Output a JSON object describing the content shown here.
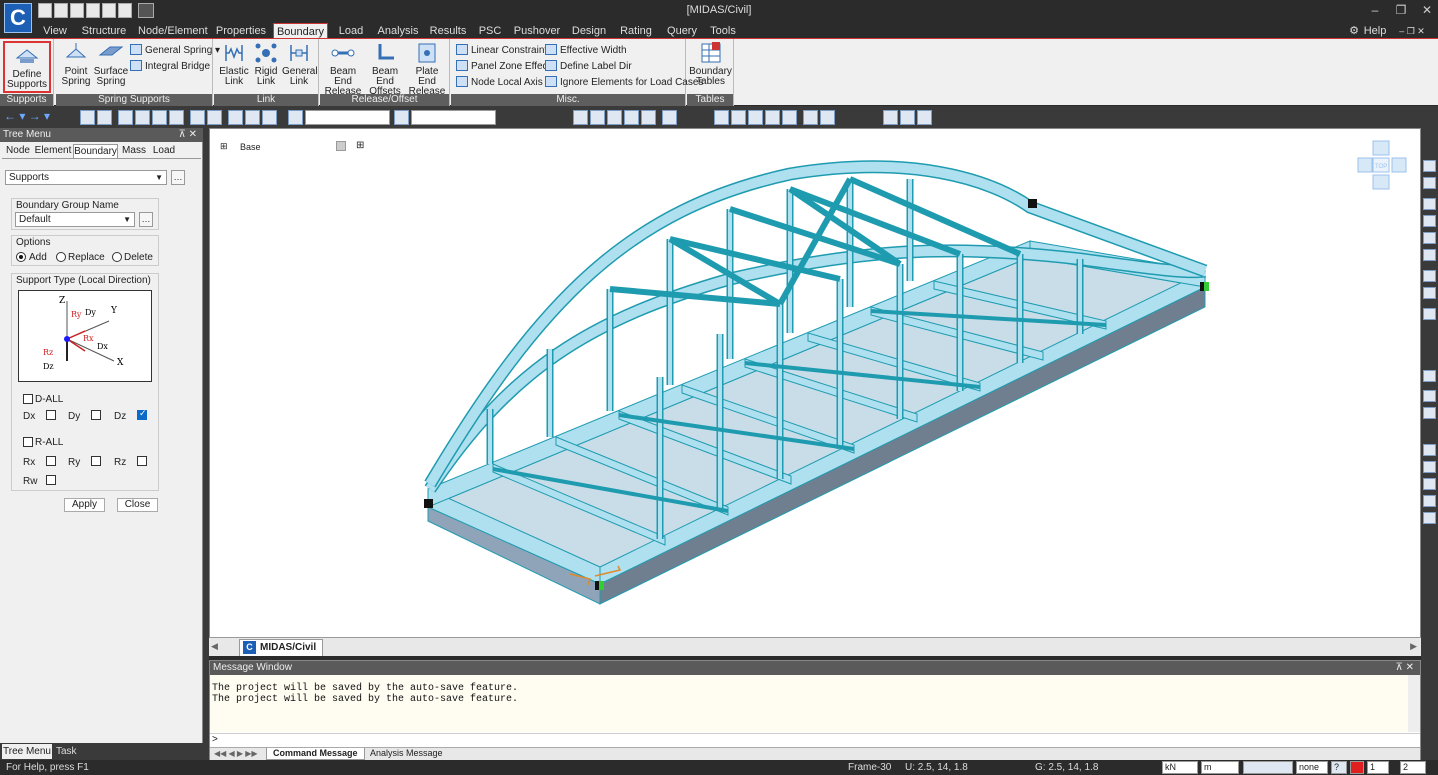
{
  "app": {
    "title": "[MIDAS/Civil]",
    "help": "Help"
  },
  "menu": [
    "View",
    "Structure",
    "Node/Element",
    "Properties",
    "Boundary",
    "Load",
    "Analysis",
    "Results",
    "PSC",
    "Pushover",
    "Design",
    "Rating",
    "Query",
    "Tools"
  ],
  "ribbon": {
    "supports": {
      "define": "Define\nSupports",
      "group": "Supports"
    },
    "spring": {
      "point": "Point\nSpring",
      "surface": "Surface\nSpring",
      "general": "General Spring",
      "integral": "Integral Bridge",
      "group": "Spring Supports"
    },
    "link": {
      "elastic": "Elastic\nLink",
      "rigid": "Rigid\nLink",
      "general": "General\nLink",
      "group": "Link"
    },
    "release": {
      "beam_end_release": "Beam End\nRelease",
      "beam_end_offsets": "Beam End\nOffsets",
      "plate_end_release": "Plate End\nRelease",
      "group": "Release/Offset"
    },
    "misc": {
      "linear": "Linear Constraints",
      "panel": "Panel Zone Effects",
      "node_axis": "Node Local Axis",
      "eff_width": "Effective Width",
      "label_dir": "Define Label Dir",
      "ignore": "Ignore Elements for Load Cases",
      "group": "Misc."
    },
    "tables": {
      "boundary": "Boundary\nTables",
      "group": "Tables"
    }
  },
  "tree": {
    "title": "Tree Menu",
    "tabs": [
      "Node",
      "Element",
      "Boundary",
      "Mass",
      "Load"
    ],
    "active_tab": "Boundary",
    "function": "Supports",
    "group_label": "Boundary Group Name",
    "group_value": "Default",
    "options_label": "Options",
    "options": [
      "Add",
      "Replace",
      "Delete"
    ],
    "support_type_label": "Support Type (Local Direction)",
    "diagram_labels": {
      "z": "Z",
      "y": "Y",
      "x": "X",
      "dy": "Dy",
      "dx": "Dx",
      "dz": "Dz",
      "ry": "Ry",
      "rx": "Rx",
      "rz": "Rz"
    },
    "d_all": "D-ALL",
    "r_all": "R-ALL",
    "dofs": {
      "dx": "Dx",
      "dy": "Dy",
      "dz": "Dz",
      "rx": "Rx",
      "ry": "Ry",
      "rz": "Rz",
      "rw": "Rw"
    },
    "apply": "Apply",
    "close": "Close",
    "bottom_tabs": [
      "Tree Menu",
      "Task Pane"
    ]
  },
  "view": {
    "base_label": "Base",
    "tab": "MIDAS/Civil",
    "cube_label": "TOP"
  },
  "messages": {
    "title": "Message Window",
    "lines": [
      "The project will be saved by the auto-save feature.",
      "The project will be saved by the auto-save feature."
    ],
    "prompt": ">",
    "tabs": [
      "Command Message",
      "Analysis Message"
    ]
  },
  "status": {
    "help": "For Help, press F1",
    "frame": "Frame-30",
    "u": "U: 2.5, 14, 1.8",
    "g": "G: 2.5, 14, 1.8",
    "force_unit": "kN",
    "length_unit": "m",
    "filter": "none",
    "page": "1",
    "page2": "2"
  },
  "colors": {
    "accent": "#c33",
    "steel": "#aee0ef",
    "steel_edge": "#1f9bb0",
    "node": "#1a1aff"
  }
}
